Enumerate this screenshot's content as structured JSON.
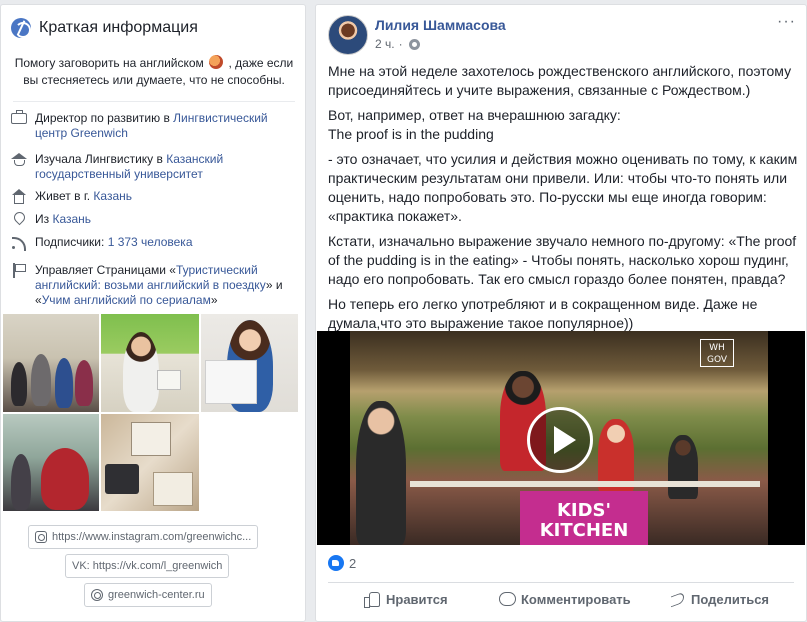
{
  "intro": {
    "title": "Краткая информация",
    "bio_before": "Помогу заговорить на английском",
    "bio_after": ", даже если вы стесняетесь или думаете, что не способны.",
    "rows": [
      {
        "icon": "briefcase-icon",
        "prefix": "Директор по развитию в ",
        "link": "Лингвистический центр Greenwich",
        "suffix": ""
      },
      {
        "icon": "graduation-cap-icon",
        "prefix": "Изучала Лингвистику в ",
        "link": "Казанский государственный университет",
        "suffix": ""
      },
      {
        "icon": "home-icon",
        "prefix": "Живет в г. ",
        "link": "Казань",
        "suffix": ""
      },
      {
        "icon": "location-pin-icon",
        "prefix": "Из ",
        "link": "Казань",
        "suffix": ""
      },
      {
        "icon": "rss-icon",
        "prefix": "Подписчики: ",
        "link": "1 373 человека",
        "suffix": ""
      }
    ],
    "pages_row": {
      "icon": "flag-icon",
      "prefix": "Управляет Страницами «",
      "link1": "Туристический английский: возьми английский в поездку",
      "mid": "» и «",
      "link2": "Учим английский по сериалам",
      "suffix": "»"
    },
    "links": {
      "instagram": "https://www.instagram.com/greenwichc...",
      "vk": "VK: https://vk.com/l_greenwich",
      "website": "greenwich-center.ru"
    }
  },
  "post": {
    "author": "Лилия Шаммасова",
    "time": "2 ч.",
    "dot": "·",
    "more": "···",
    "paragraphs": {
      "p1": "Мне на этой неделе захотелось рождественского английского, поэтому присоединяйтесь и учите выражения, связанные с Рождеством.)",
      "p2a": "Вот, например, ответ на вчерашнюю загадку:",
      "p2b": "The proof is in the pudding",
      "p3": "- это означает, что усилия и действия можно оценивать по тому, к каким практическим результатам они привели. Или: чтобы что-то понять или оценить, надо попробовать это. По-русски мы еще иногда говорим: «практика покажет».",
      "p4": "Кстати, изначально выражение звучало немного по-другому: «The proof of the pudding is in the eating» - Чтобы понять, насколько хорош пудинг, надо его попробовать. Так его смысл гораздо более понятен, правда?",
      "p5": "Но теперь его легко употребляют и в сокращенном виде. Даже не думала,что это выражение такое популярное))"
    },
    "video": {
      "banner": "KIDS' KITCHEN",
      "logo": "WH GOV"
    },
    "reactions_count": "2",
    "actions": {
      "like": "Нравится",
      "comment": "Комментировать",
      "share": "Поделиться"
    }
  },
  "colors": {
    "link": "#385898",
    "like_blue": "#1877f2",
    "banner_magenta": "#c42d8f"
  }
}
